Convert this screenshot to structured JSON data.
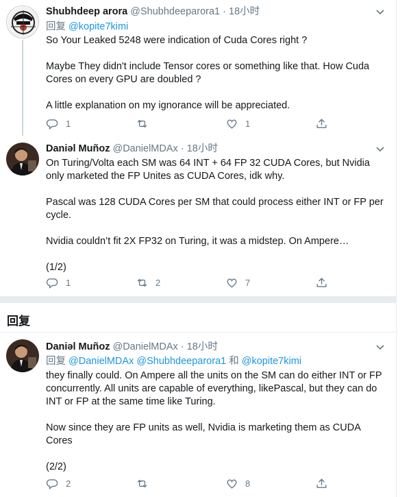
{
  "tweets": [
    {
      "display_name": "Shubhdeep arora",
      "handle": "@Shubhdeeparora1",
      "separator": "·",
      "time": "18小时",
      "reply_prefix": "回复",
      "reply_mention": "@kopite7kimi",
      "body": "So Your Leaked 5248 were indication of Cuda Cores right ?\n\nMaybe They didn't include Tensor cores or something like that. How Cuda Cores on every GPU are doubled ?\n\nA little explanation on my ignorance will be appreciated.",
      "reply_count": "1",
      "retweet_count": "",
      "like_count": "1"
    },
    {
      "display_name": "Daniəl Muñoz",
      "handle": "@DanielMDAx",
      "separator": "·",
      "time": "18小时",
      "body": "On Turing/Volta each SM was 64 INT + 64 FP 32 CUDA Cores, but Nvidia only marketed the FP Unites as CUDA Cores, idk why.\n\nPascal was 128 CUDA Cores per SM that could process either INT or FP per cycle.\n\nNvidia couldn’t fit 2X FP32 on Turing, it was a midstep. On Ampere…\n\n(1/2)",
      "reply_count": "1",
      "retweet_count": "2",
      "like_count": "7"
    },
    {
      "display_name": "Daniəl Muñoz",
      "handle": "@DanielMDAx",
      "separator": "·",
      "time": "18小时",
      "reply_prefix": "回复",
      "reply_mention_1": "@DanielMDAx",
      "reply_mention_2": "@Shubhdeeparora1",
      "reply_and": "和",
      "reply_mention_3": "@kopite7kimi",
      "body": "they finally could. On Ampere all the units on the SM can do either INT or FP concurrently. All units are capable of everything, likePascal, but they can do INT or FP at the same time like Turing.\n\nNow since they are FP units as well, Nvidia is marketing them as CUDA Cores\n\n(2/2)",
      "reply_count": "2",
      "retweet_count": "",
      "like_count": "8"
    }
  ],
  "section_title": "回复",
  "colors": {
    "text": "#14171a",
    "muted": "#657786",
    "link": "#1b95e0",
    "separator": "#e6ecf0",
    "thread_line": "#ccd6dd"
  },
  "icons": [
    "reply-icon",
    "retweet-icon",
    "like-icon",
    "share-icon",
    "chevron-down-icon"
  ]
}
